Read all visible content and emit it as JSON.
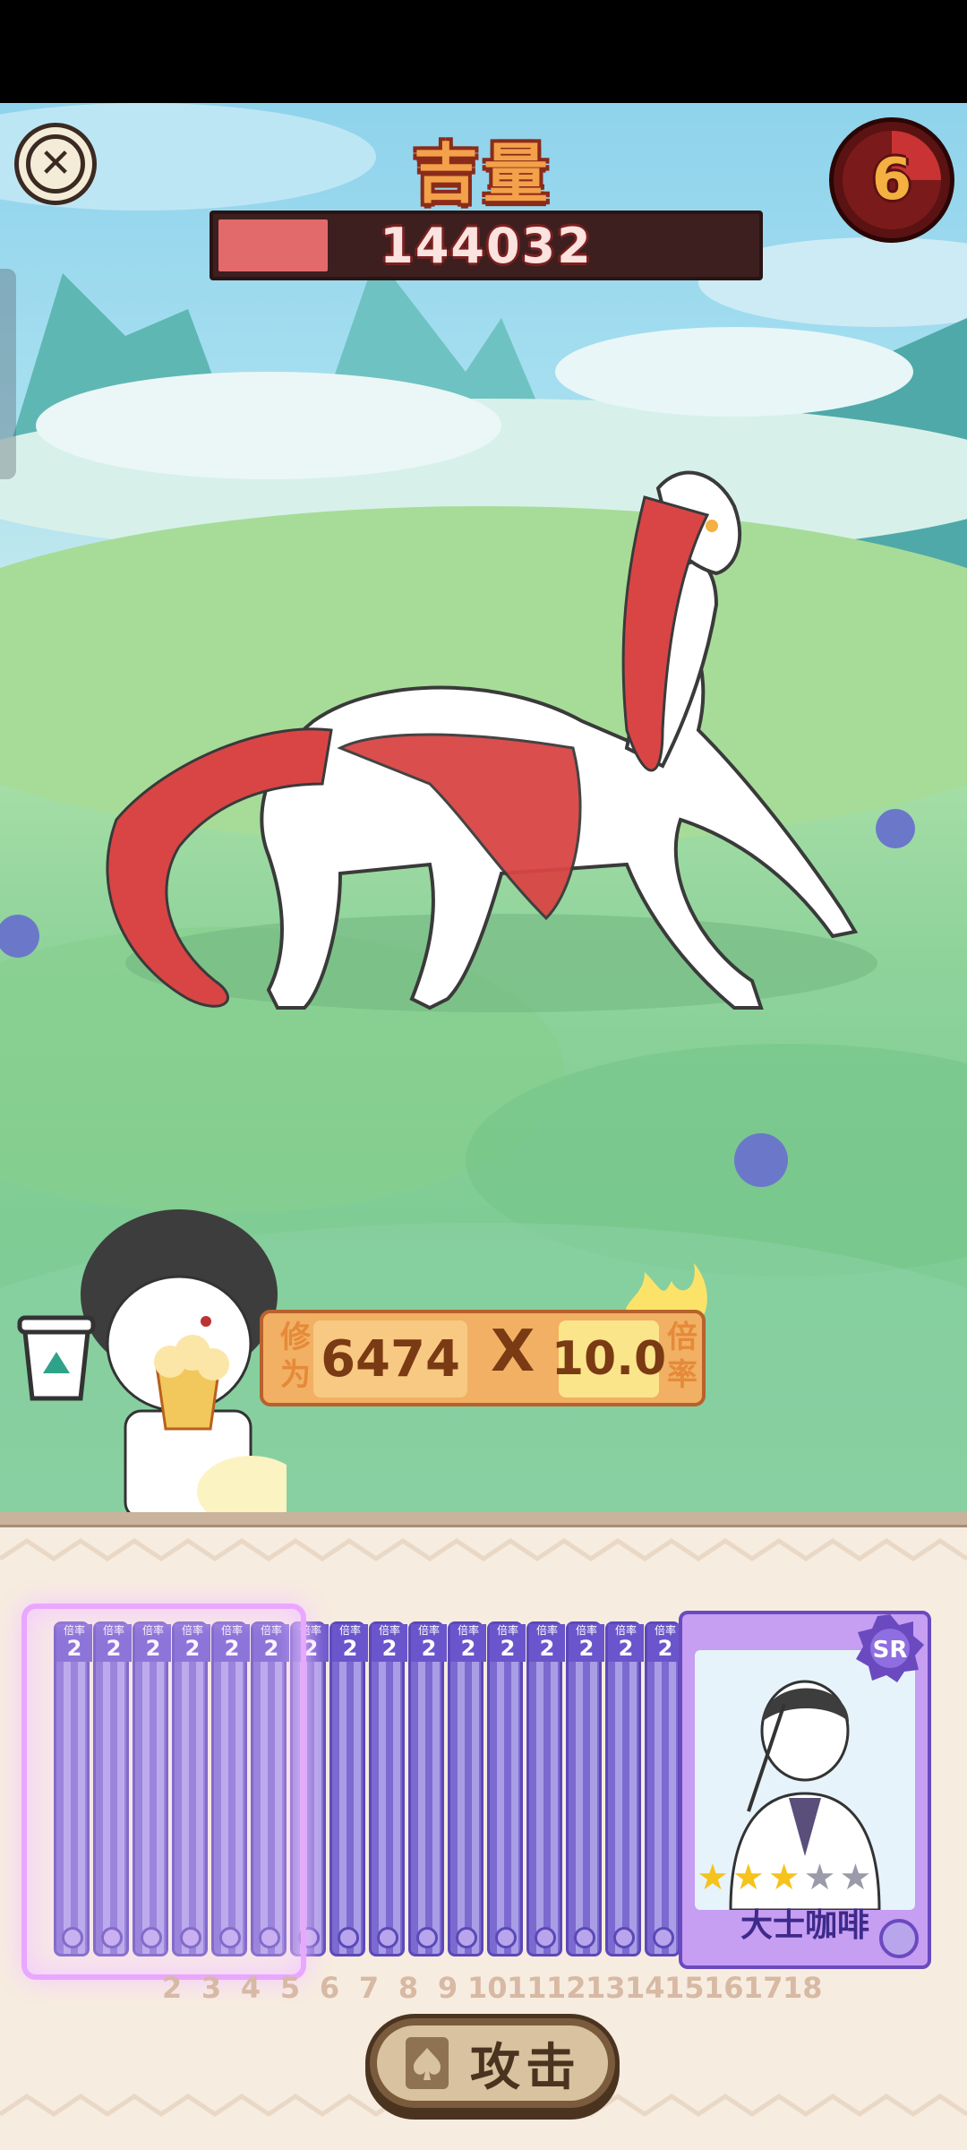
{
  "boss": {
    "name": "吉量",
    "hp_value": "144032",
    "hp_fraction": 0.2
  },
  "round": {
    "count": "6"
  },
  "score": {
    "label": "修为",
    "value": "6474",
    "operator": "X",
    "multiplier": "10.0",
    "multiplier_label": "倍率"
  },
  "hand": {
    "stacked_card_tag": "倍率",
    "stacked_card_value": "2",
    "stacked_card_count": 16,
    "main_card": {
      "rarity": "SR",
      "name": "大士咖啡",
      "stars_filled": 3,
      "stars_total": 5
    }
  },
  "card_indices": [
    "2",
    "3",
    "4",
    "5",
    "6",
    "7",
    "8",
    "9",
    "10",
    "11",
    "12",
    "13",
    "14",
    "15",
    "16",
    "17",
    "18"
  ],
  "actions": {
    "attack_label": "攻击"
  },
  "icons": {
    "close": "close-icon",
    "cup": "coffee-cup-icon",
    "attack": "card-spade-icon",
    "timer": "round-timer-icon"
  },
  "colors": {
    "title": "#f3a14a",
    "hp_fill": "#e26a6a",
    "panel_bg": "#f7ece0",
    "card_purple": "#c69ef2"
  }
}
